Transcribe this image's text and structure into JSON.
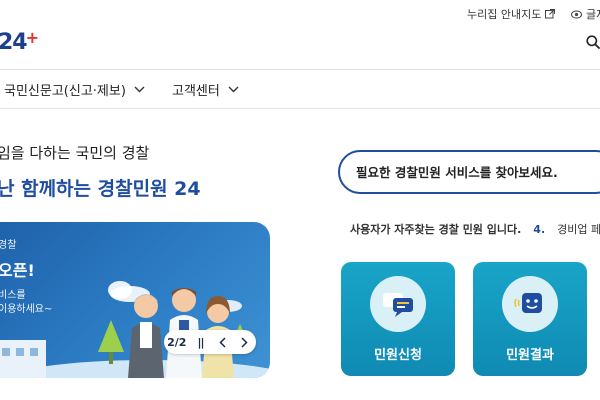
{
  "topbar": {
    "sitemap_label": "누리집 안내지도",
    "fontsize_label": "글자"
  },
  "header": {
    "logo_text": "24",
    "logo_plus": "+"
  },
  "nav": {
    "items": [
      {
        "label": "국민신문고(신고·제보)"
      },
      {
        "label": "고객센터"
      }
    ]
  },
  "hero": {
    "subtitle": "임을 다하는 국민의 경찰",
    "title": "난 함께하는 경찰민원 24"
  },
  "banner": {
    "small": "경찰",
    "big": "오픈!",
    "desc_line1": "비스를",
    "desc_line2": "이용하세요~",
    "pager_text": "2/2",
    "pause_symbol": "||"
  },
  "search": {
    "placeholder": "필요한 경찰민원 서비스를 찾아보세요."
  },
  "frequent": {
    "label": "사용자가 자주찾는 경찰 민원 입니다.",
    "number": "4.",
    "item": "경비업 페"
  },
  "cards": [
    {
      "label": "민원신청",
      "icon": "chat-bubble-icon"
    },
    {
      "label": "민원결과",
      "icon": "result-face-icon"
    }
  ],
  "colors": {
    "primary": "#1f4da0",
    "card": "#0f8ab3",
    "banner": "#2c7cc4",
    "accent_red": "#e8322c"
  }
}
